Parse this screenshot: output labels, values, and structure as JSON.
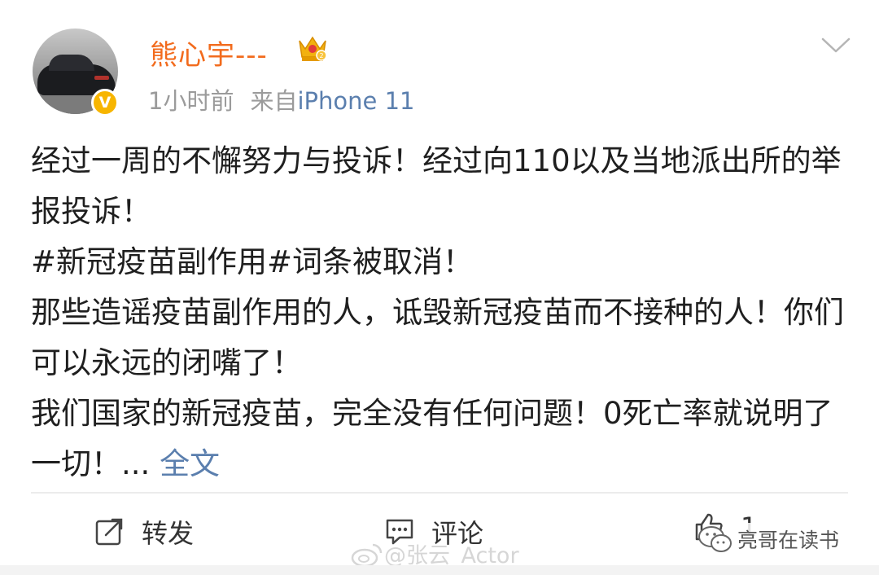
{
  "post": {
    "username": "熊心宇---",
    "time": "1小时前",
    "source_prefix": "来自",
    "source": "iPhone 11",
    "verified_badge": "V",
    "lines": [
      "经过一周的不懈努力与投诉！经过向110以及当地派出所的举报投诉！",
      "#新冠疫苗副作用#词条被取消！",
      "那些造谣疫苗副作用的人，诋毁新冠疫苗而不接种的人！你们可以永远的闭嘴了！"
    ],
    "last_line": "我们国家的新冠疫苗，完全没有任何问题！0死亡率就说明了一切！...",
    "full_text_link": "全文"
  },
  "actions": {
    "repost": "转发",
    "comment": "评论",
    "like_count": "1"
  },
  "watermarks": {
    "center": "@张云_Actor",
    "right": "亮哥在读书"
  },
  "colors": {
    "username": "#f26b1d",
    "link": "#5b7fae",
    "meta": "#9b9b9b",
    "verified": "#f7b500"
  },
  "icons": {
    "avatar": "avatar-car-photo",
    "verified": "verified-badge-icon",
    "vip": "crown-icon",
    "menu": "chevron-down-icon",
    "repost": "repost-icon",
    "comment": "comment-icon",
    "like": "like-icon"
  }
}
